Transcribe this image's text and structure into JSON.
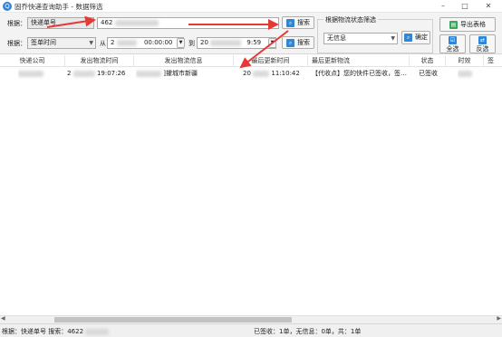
{
  "window": {
    "title": "固乔快递查询助手 - 数据筛选",
    "minimize": "–",
    "maximize": "□",
    "close": "✕"
  },
  "filter": {
    "row1_label": "根据：",
    "row1_type": "快递单号",
    "tracking_value": "462",
    "search_label": "搜索",
    "row2_label": "根据：",
    "row2_type": "签单时间",
    "from_label": "从",
    "from_date": "2",
    "from_time": "00:00:00",
    "to_label": "到",
    "to_date": "20",
    "to_time": "9:59",
    "search2_label": "搜索"
  },
  "status_filter": {
    "title": "根据物流状态筛选",
    "selected": "无信息",
    "confirm_label": "确定"
  },
  "actions": {
    "export_label": "导出表格",
    "select_all_label": "全选",
    "invert_label": "反选"
  },
  "table": {
    "columns": [
      "快递公司",
      "发出物流时间",
      "发出物流信息",
      "最后更新时间",
      "最后更新物流",
      "状态",
      "时效",
      "签"
    ],
    "rows": [
      {
        "company": "",
        "send_time": "19:07:26",
        "send_time_prefix": "2",
        "send_info": "]攉城市新疆",
        "update_time": "11:10:42",
        "update_time_prefix": "20",
        "update_info": "【代收点】您的快件已签收，签…",
        "status": "已签收",
        "duration": "",
        "extra": ""
      }
    ]
  },
  "statusbar": {
    "query_text": "根据：快递单号 搜索：4622",
    "summary_text": "已签收：1单，无信息：0单，共：1单"
  },
  "colors": {
    "accent_blue": "#2f86d6",
    "arrow_red": "#e53935"
  }
}
